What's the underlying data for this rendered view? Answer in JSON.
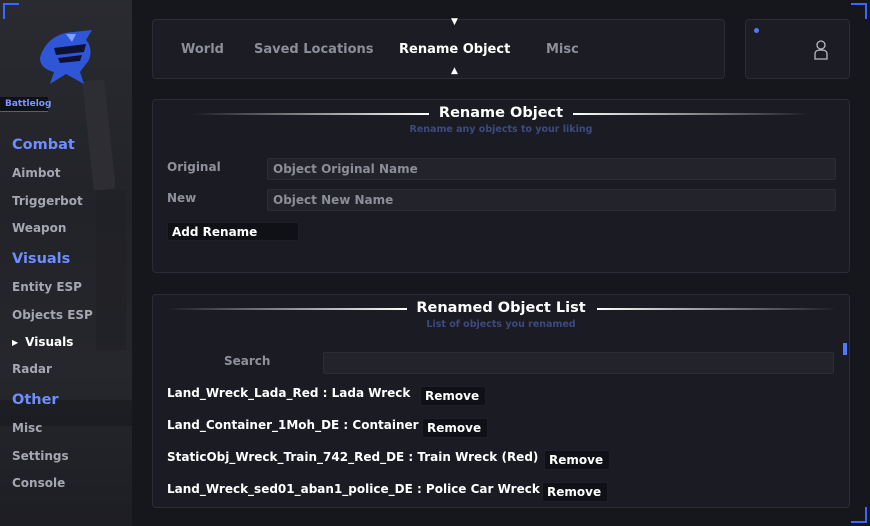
{
  "brand": {
    "name": "Battlelog"
  },
  "sidebar": {
    "sections": [
      {
        "title": "Combat",
        "items": [
          "Aimbot",
          "Triggerbot",
          "Weapon"
        ]
      },
      {
        "title": "Visuals",
        "items": [
          "Entity ESP",
          "Objects ESP",
          "Visuals",
          "Radar"
        ]
      },
      {
        "title": "Other",
        "items": [
          "Misc",
          "Settings",
          "Console"
        ]
      }
    ],
    "active_item": "Visuals"
  },
  "tabs": {
    "items": [
      "World",
      "Saved Locations",
      "Rename Object",
      "Misc"
    ],
    "active": "Rename Object"
  },
  "rename": {
    "title": "Rename Object",
    "subtitle": "Rename any objects to your liking",
    "original_label": "Original",
    "original_placeholder": "Object Original Name",
    "new_label": "New",
    "new_placeholder": "Object New Name",
    "add_button": "Add Rename"
  },
  "list": {
    "title": "Renamed Object List",
    "subtitle": "List of objects you renamed",
    "search_label": "Search",
    "search_value": "",
    "remove_label": "Remove",
    "rows": [
      {
        "text": "Land_Wreck_Lada_Red  :  Lada Wreck"
      },
      {
        "text": "Land_Container_1Moh_DE  :  Container"
      },
      {
        "text": "StaticObj_Wreck_Train_742_Red_DE  :  Train Wreck (Red)"
      },
      {
        "text": "Land_Wreck_sed01_aban1_police_DE  :  Police Car Wreck"
      }
    ]
  },
  "colors": {
    "accent": "#6e8eff",
    "background": "#16171d",
    "panel": "#1b1c23"
  },
  "icons": {
    "logo": "knight-helmet-logo",
    "user": "user-icon",
    "status": "status-dot"
  }
}
